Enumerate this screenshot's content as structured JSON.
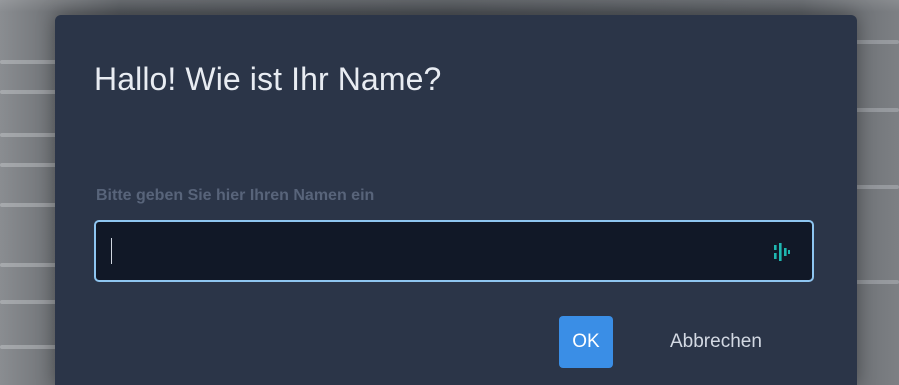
{
  "dialog": {
    "title": "Hallo! Wie ist Ihr Name?",
    "field_label": "Bitte geben Sie hier Ihren Namen ein",
    "input_value": "",
    "input_placeholder": "",
    "ok_label": "OK",
    "cancel_label": "Abbrechen"
  },
  "icons": {
    "input_icon": "password-manager-icon"
  },
  "colors": {
    "dialog_bg": "#2b3548",
    "input_bg": "#111827",
    "input_border": "#8ec5f0",
    "ok_button": "#3a8ee6",
    "label_text": "#58647a",
    "icon_accent": "#1fb6b0"
  }
}
